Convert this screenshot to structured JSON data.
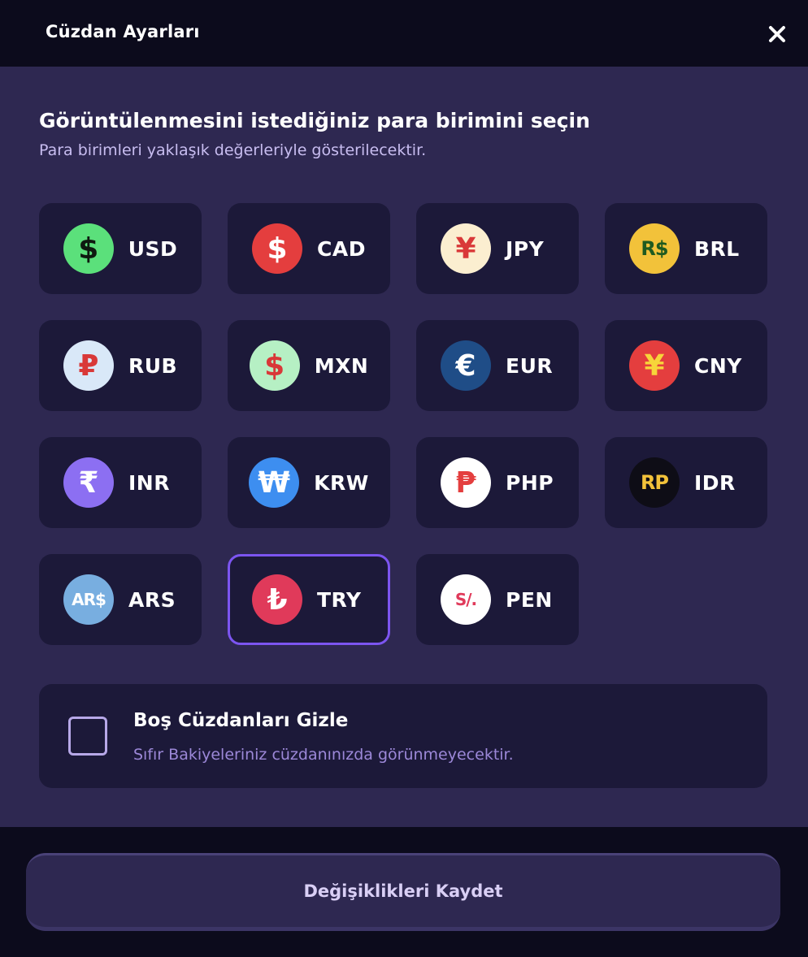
{
  "header": {
    "title": "Cüzdan Ayarları",
    "close_icon": "close-icon"
  },
  "main": {
    "heading": "Görüntülenmesini istediğiniz para birimini seçin",
    "subheading": "Para birimleri yaklaşık değerleriyle gösterilecektir.",
    "currencies": [
      {
        "code": "USD",
        "symbol": "$",
        "bg": "#5be07b",
        "fg": "#0e1a10",
        "icon": "dollar-icon",
        "selected": false
      },
      {
        "code": "CAD",
        "symbol": "$",
        "bg": "#e43e3e",
        "fg": "#ffffff",
        "icon": "dollar-icon",
        "selected": false
      },
      {
        "code": "JPY",
        "symbol": "¥",
        "bg": "#fbeed0",
        "fg": "#d93838",
        "icon": "yen-icon",
        "selected": false
      },
      {
        "code": "BRL",
        "symbol": "R$",
        "bg": "#f2c23a",
        "fg": "#1f5a20",
        "icon": "real-icon",
        "selected": false
      },
      {
        "code": "RUB",
        "symbol": "₽",
        "bg": "#d9e8f8",
        "fg": "#d93838",
        "icon": "ruble-icon",
        "selected": false
      },
      {
        "code": "MXN",
        "symbol": "$",
        "bg": "#b6f0c4",
        "fg": "#d93838",
        "icon": "peso-icon",
        "selected": false
      },
      {
        "code": "EUR",
        "symbol": "€",
        "bg": "#1f4d87",
        "fg": "#ffffff",
        "icon": "euro-icon",
        "selected": false
      },
      {
        "code": "CNY",
        "symbol": "¥",
        "bg": "#e43e3e",
        "fg": "#f7d53a",
        "icon": "yuan-icon",
        "selected": false
      },
      {
        "code": "INR",
        "symbol": "₹",
        "bg": "#8c6ff2",
        "fg": "#ffffff",
        "icon": "rupee-icon",
        "selected": false
      },
      {
        "code": "KRW",
        "symbol": "₩",
        "bg": "#3d8ef0",
        "fg": "#ffffff",
        "icon": "won-icon",
        "selected": false
      },
      {
        "code": "PHP",
        "symbol": "₱",
        "bg": "#ffffff",
        "fg": "#e43e3e",
        "icon": "peso-icon",
        "selected": false
      },
      {
        "code": "IDR",
        "symbol": "RP",
        "bg": "#0e0d16",
        "fg": "#f2c23a",
        "icon": "rupiah-icon",
        "selected": false
      },
      {
        "code": "ARS",
        "symbol": "AR$",
        "bg": "#78aee0",
        "fg": "#ffffff",
        "icon": "ars-icon",
        "selected": false
      },
      {
        "code": "TRY",
        "symbol": "₺",
        "bg": "#e03a5a",
        "fg": "#ffffff",
        "icon": "lira-icon",
        "selected": true
      },
      {
        "code": "PEN",
        "symbol": "S/.",
        "bg": "#ffffff",
        "fg": "#e03a5a",
        "icon": "sol-icon",
        "selected": false
      }
    ]
  },
  "hide_empty": {
    "title": "Boş Cüzdanları Gizle",
    "description": "Sıfır Bakiyeleriniz cüzdanınızda görünmeyecektir.",
    "checked": false
  },
  "footer": {
    "save_label": "Değişiklikleri Kaydet"
  },
  "colors": {
    "accent": "#7c55f0",
    "panel": "#2e2851",
    "card": "#1c1939",
    "background": "#0c0b1c"
  }
}
